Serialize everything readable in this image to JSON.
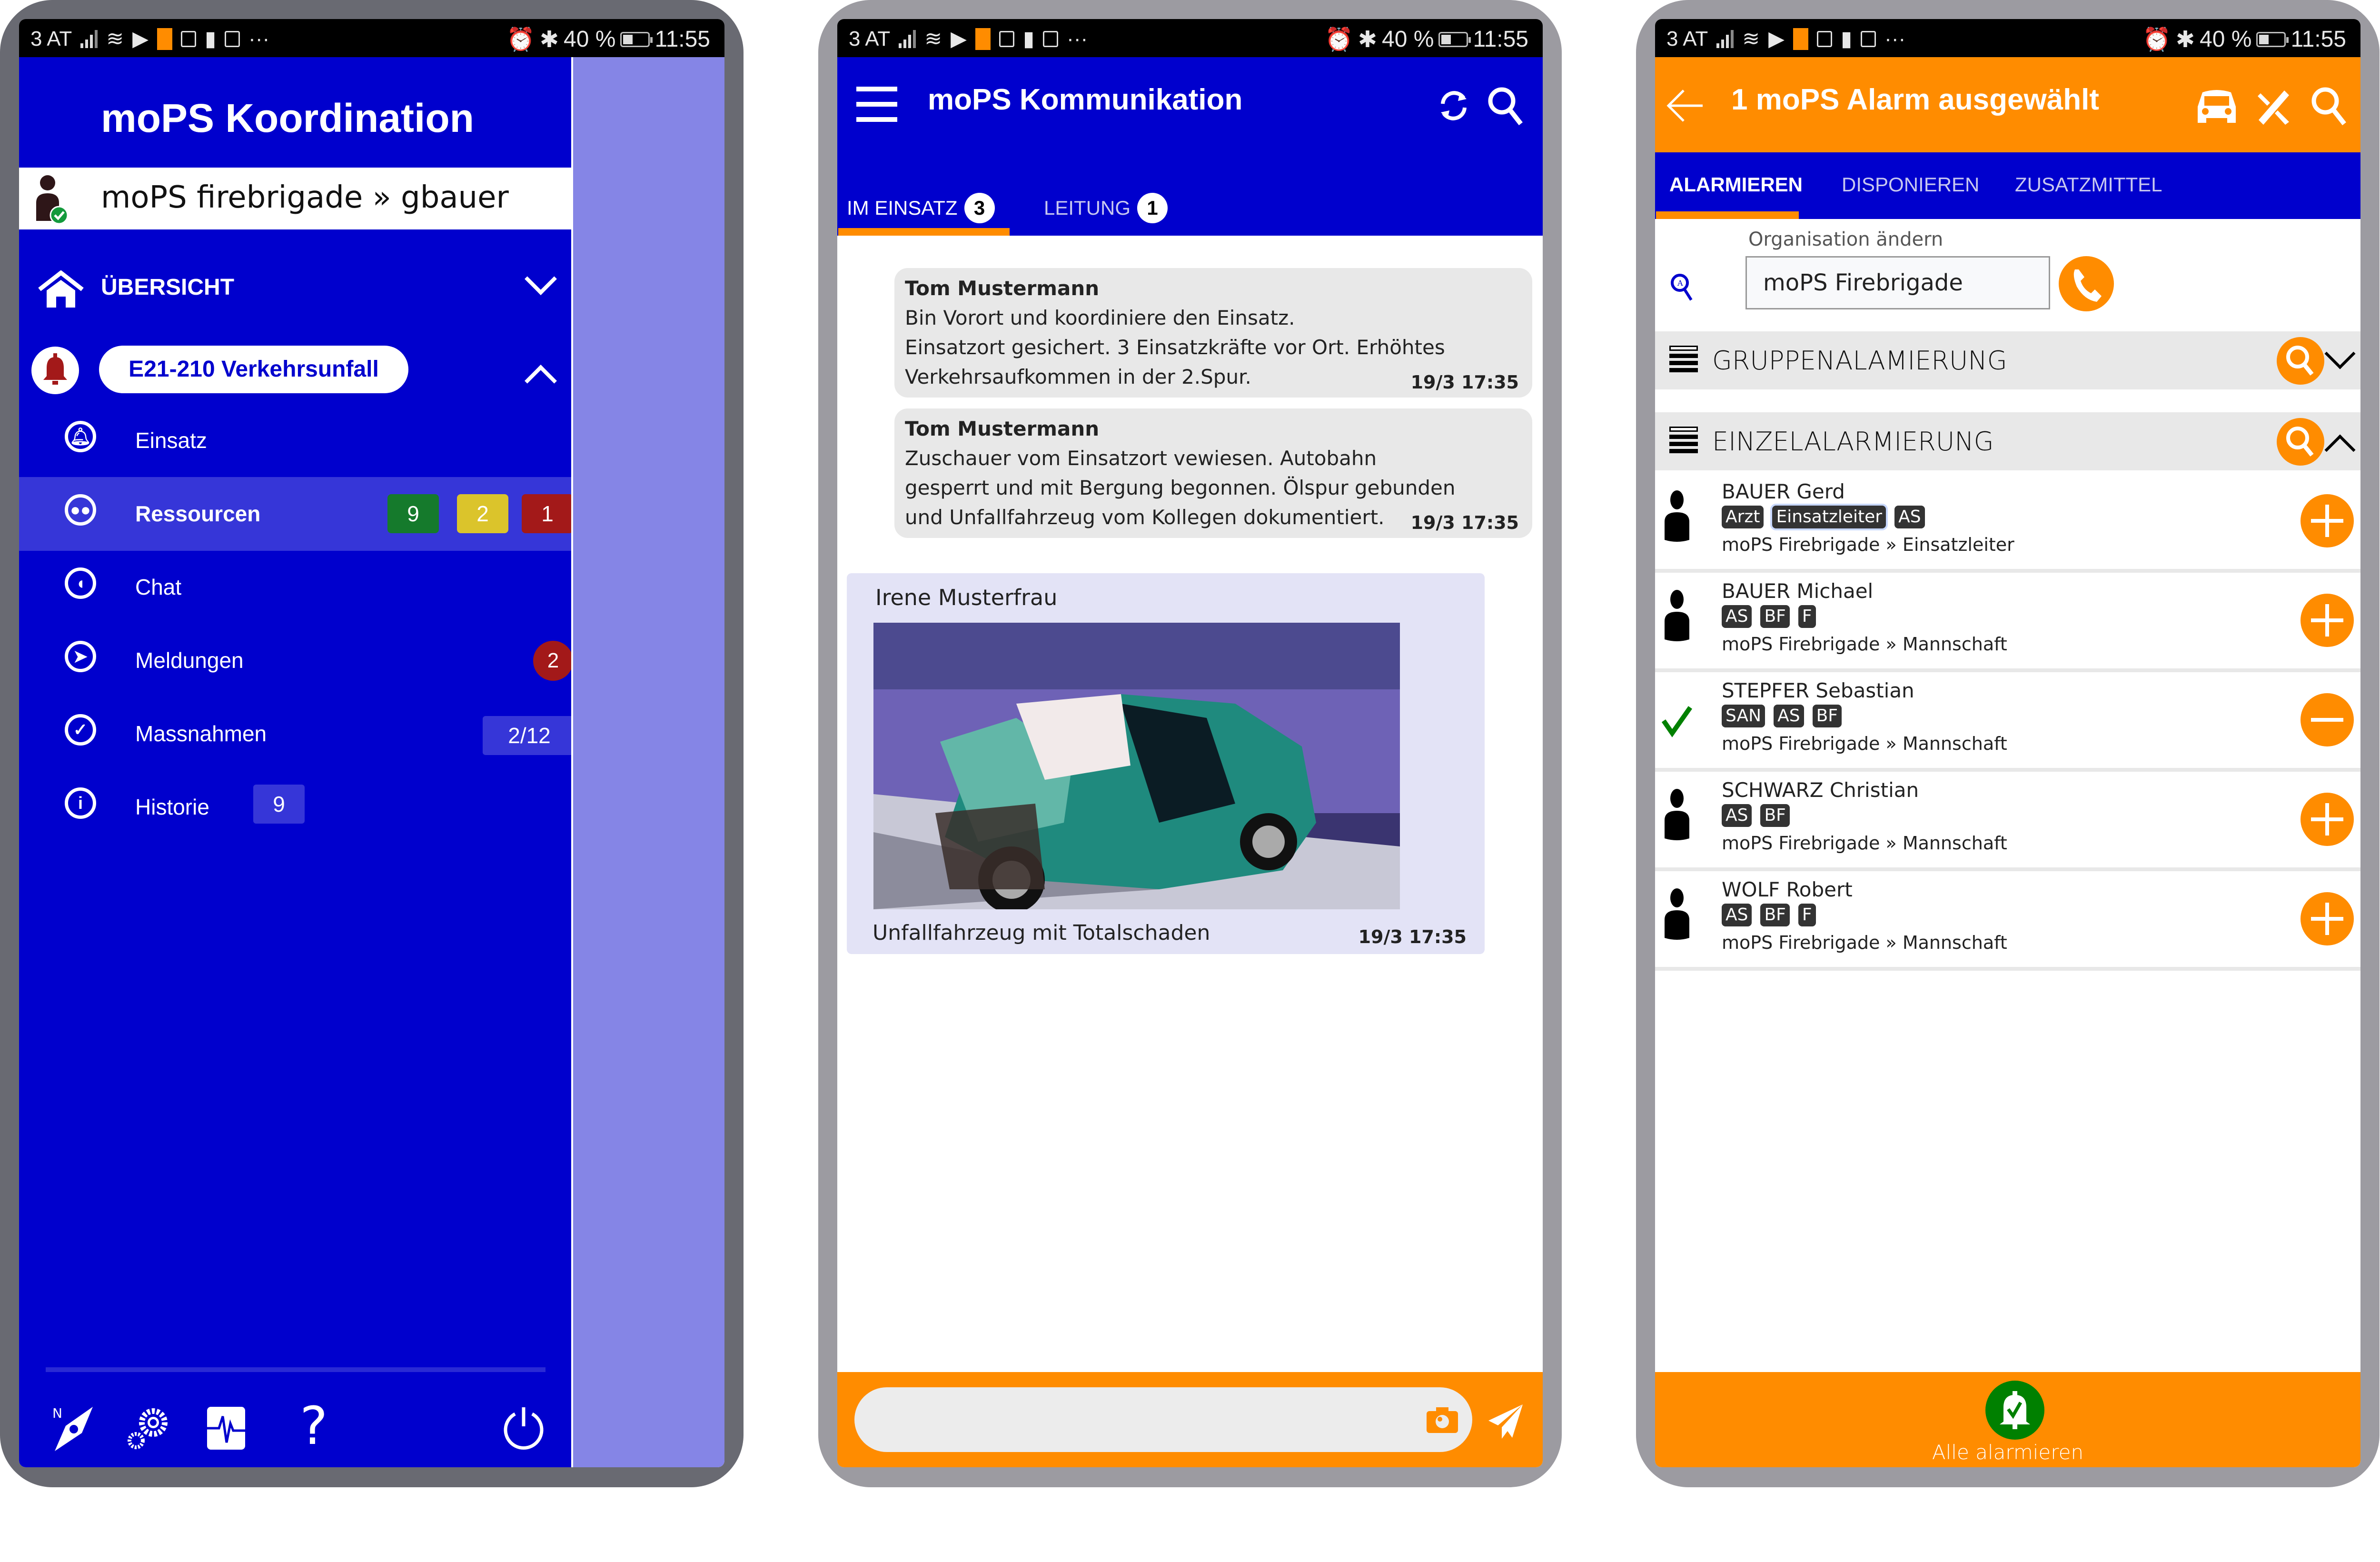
{
  "status_bar": {
    "carrier": "3 AT",
    "battery": "40 %",
    "time": "11:55"
  },
  "coordination": {
    "title": "moPS Koordination",
    "user": "moPS firebrigade » gbauer",
    "overview_label": "ÜBERSICHT",
    "incident": "E21-210 Verkehrsunfall",
    "items": [
      {
        "label": "Einsatz",
        "icon": "bell-icon"
      },
      {
        "label": "Ressourcen",
        "icon": "group-icon",
        "badges": [
          "9",
          "2",
          "1"
        ],
        "badge_colors": [
          "#157a2c",
          "#dbc42b",
          "#a31919"
        ]
      },
      {
        "label": "Chat",
        "icon": "chat-icon"
      },
      {
        "label": "Meldungen",
        "icon": "send-icon",
        "badge": "2"
      },
      {
        "label": "Massnahmen",
        "icon": "check-icon",
        "badge": "2/12"
      },
      {
        "label": "Historie",
        "icon": "info-icon",
        "badge": "9"
      }
    ],
    "footer_icons": [
      "compass-icon",
      "settings-icon",
      "activity-icon",
      "help-icon",
      "power-icon"
    ]
  },
  "communication": {
    "title": "moPS Kommunikation",
    "tabs": [
      {
        "label": "IM EINSATZ",
        "count": "3",
        "active": true
      },
      {
        "label": "LEITUNG",
        "count": "1",
        "active": false
      }
    ],
    "messages": [
      {
        "author": "Tom  Mustermann",
        "text": "Bin Vorort und koordiniere den Einsatz.\nEinsatzort gesichert. 3 Einsatzkräfte vor Ort. Erhöhtes Verkehrsaufkommen in der 2.Spur.",
        "time": "19/3 17:35"
      },
      {
        "author": "Tom  Mustermann",
        "text": "Zuschauer vom Einsatzort vewiesen. Autobahn gesperrt und mit  Bergung begonnen. Ölspur gebunden und Unfallfahrzeug vom Kollegen dokumentiert.",
        "time": "19/3 17:35"
      },
      {
        "author": "Irene Musterfrau",
        "caption": "Unfallfahrzeug mit Totalschaden",
        "time": "19/3 17:35",
        "image": "crashed-car-photo"
      }
    ],
    "composer_placeholder": ""
  },
  "alarm": {
    "title": "1 moPS Alarm ausgewählt",
    "tabs": [
      {
        "label": "ALARMIEREN",
        "active": true
      },
      {
        "label": "DISPONIEREN",
        "active": false
      },
      {
        "label": "ZUSATZMITTEL",
        "active": false
      }
    ],
    "org_label": "Organisation ändern",
    "org_value": "moPS Firebrigade",
    "group_section": "GRUPPENALAMIERUNG",
    "single_section": "EINZELALARMIERUNG",
    "persons": [
      {
        "name": "BAUER Gerd",
        "tags": [
          "Arzt",
          "Einsatzleiter",
          "AS"
        ],
        "org": "moPS Firebrigade » Einsatzleiter",
        "selected": false
      },
      {
        "name": "BAUER Michael",
        "tags": [
          "AS",
          "BF",
          "F"
        ],
        "org": "moPS Firebrigade » Mannschaft",
        "selected": false
      },
      {
        "name": "STEPFER Sebastian",
        "tags": [
          "SAN",
          "AS",
          "BF"
        ],
        "org": "moPS Firebrigade » Mannschaft",
        "selected": true
      },
      {
        "name": "SCHWARZ Christian",
        "tags": [
          "AS",
          "BF"
        ],
        "org": "moPS Firebrigade » Mannschaft",
        "selected": false
      },
      {
        "name": "WOLF Robert",
        "tags": [
          "AS",
          "BF",
          "F"
        ],
        "org": "moPS Firebrigade » Mannschaft",
        "selected": false
      }
    ],
    "alarm_all_label": "Alle alarmieren"
  },
  "colors": {
    "primary_blue": "#0000cd",
    "accent_orange": "#ff8c00",
    "success_green": "#008000"
  }
}
